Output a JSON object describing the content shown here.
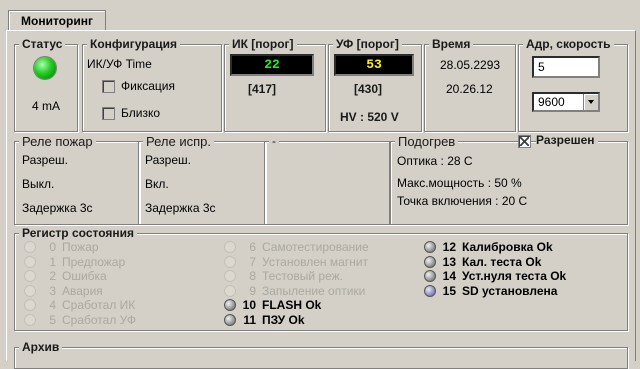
{
  "tab": {
    "label": "Мониторинг"
  },
  "status": {
    "title": "Статус",
    "current": "4 mA",
    "led_color": "#22cc22"
  },
  "config": {
    "title": "Конфигурация",
    "mode": "ИК/УФ Time",
    "fixation_label": "Фиксация",
    "close_label": "Близко",
    "fixation_checked": false,
    "close_checked": false
  },
  "ik": {
    "title": "ИК [порог]",
    "value": "22",
    "threshold": "[417]",
    "color": "#22ee22"
  },
  "uf": {
    "title": "УФ [порог]",
    "value": "53",
    "threshold": "[430]",
    "color": "#ffee22",
    "hv": "HV : 520 V"
  },
  "time": {
    "title": "Время",
    "date": "28.05.2293",
    "clock": "20.26.12"
  },
  "addr": {
    "title": "Адр, скорость",
    "address": "5",
    "speed": "9600"
  },
  "relay_fire": {
    "title": "Реле пожар",
    "lines": [
      "Разреш.",
      "Выкл.",
      "Задержка 3с"
    ]
  },
  "relay_fault": {
    "title": "Реле испр.",
    "lines": [
      "Разреш.",
      "Вкл.",
      "Задержка 3с"
    ]
  },
  "relay_third": {
    "title": "-"
  },
  "heating": {
    "title": "Подогрев",
    "enabled_label": "Разрешен",
    "enabled": true,
    "lines": [
      "Оптика : 28 С",
      "Макс.мощность : 50 %",
      "Точка включения : 20 С"
    ]
  },
  "register": {
    "title": "Регистр состояния",
    "items": [
      {
        "num": "0",
        "text": "Пожар",
        "state": "off"
      },
      {
        "num": "1",
        "text": "Предпожар",
        "state": "off"
      },
      {
        "num": "2",
        "text": "Ошибка",
        "state": "off"
      },
      {
        "num": "3",
        "text": "Авария",
        "state": "off"
      },
      {
        "num": "4",
        "text": "Сработал ИК",
        "state": "off"
      },
      {
        "num": "5",
        "text": "Сработал УФ",
        "state": "off"
      },
      {
        "num": "6",
        "text": "Самотестирование",
        "state": "off"
      },
      {
        "num": "7",
        "text": "Установлен магнит",
        "state": "off"
      },
      {
        "num": "8",
        "text": "Тестовый реж.",
        "state": "off"
      },
      {
        "num": "9",
        "text": "Запыление оптики",
        "state": "off"
      },
      {
        "num": "10",
        "text": "FLASH Ok",
        "state": "on"
      },
      {
        "num": "11",
        "text": "ПЗУ Ok",
        "state": "on"
      },
      {
        "num": "12",
        "text": "Калибровка Ok",
        "state": "on"
      },
      {
        "num": "13",
        "text": "Кал. теста Ok",
        "state": "on"
      },
      {
        "num": "14",
        "text": "Уст.нуля теста Ok",
        "state": "on"
      },
      {
        "num": "15",
        "text": "SD установлена",
        "state": "blue"
      }
    ]
  },
  "archive": {
    "title": "Архив"
  }
}
